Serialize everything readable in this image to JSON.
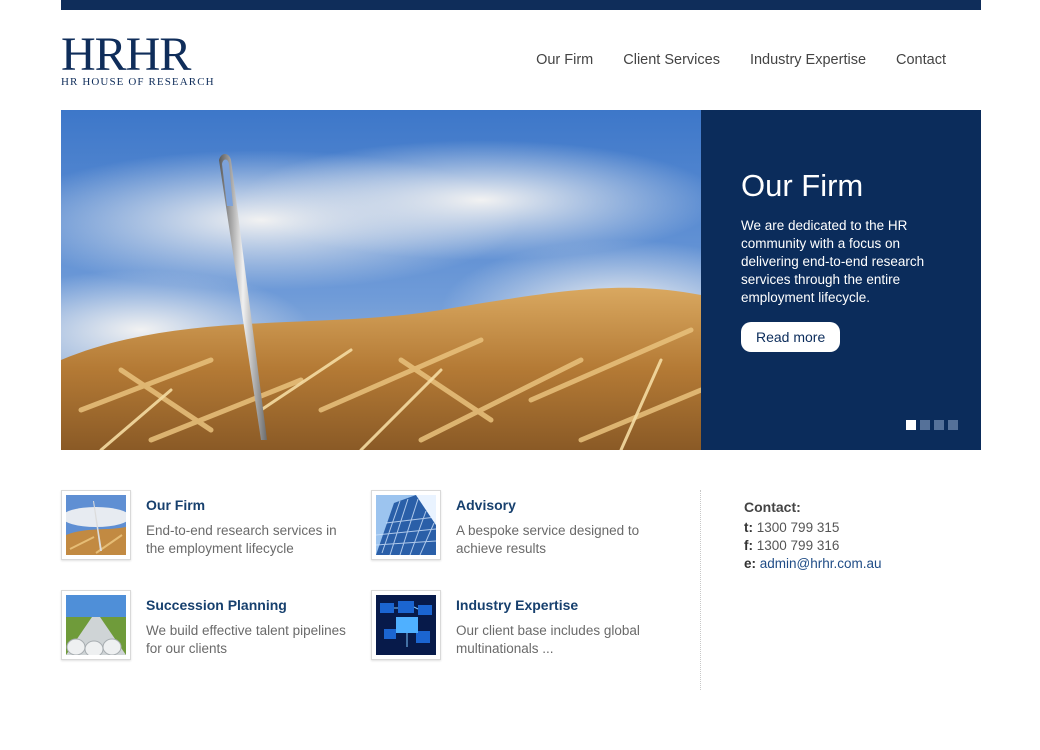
{
  "brand": {
    "logo_mark": "HRHR",
    "logo_sub": "HR HOUSE OF RESEARCH",
    "primary_color": "#0b2c5b"
  },
  "nav": {
    "items": [
      {
        "label": "Our Firm"
      },
      {
        "label": "Client Services"
      },
      {
        "label": "Industry Expertise"
      },
      {
        "label": "Contact"
      }
    ]
  },
  "hero": {
    "title": "Our Firm",
    "text": "We are dedicated to the HR community with a focus on delivering end-to-end research services through the entire employment lifecycle.",
    "button_label": "Read more",
    "slides_total": 4,
    "active_slide": 1
  },
  "features": [
    {
      "title": "Our Firm",
      "desc": "End-to-end research services in the employment lifecycle",
      "icon": "needle-haystack-thumbnail"
    },
    {
      "title": "Advisory",
      "desc": "A bespoke service designed to achieve results",
      "icon": "skyscraper-thumbnail"
    },
    {
      "title": "Succession Planning",
      "desc": "We build effective talent pipelines for our clients",
      "icon": "pipelines-thumbnail"
    },
    {
      "title": "Industry Expertise",
      "desc": "Our client base includes global multinationals ...",
      "icon": "digital-screens-thumbnail"
    }
  ],
  "contact": {
    "title": "Contact:",
    "phone_label": "t:",
    "phone": "1300 799 315",
    "fax_label": "f:",
    "fax": "1300 799 316",
    "email_label": "e:",
    "email": "admin@hrhr.com.au"
  }
}
